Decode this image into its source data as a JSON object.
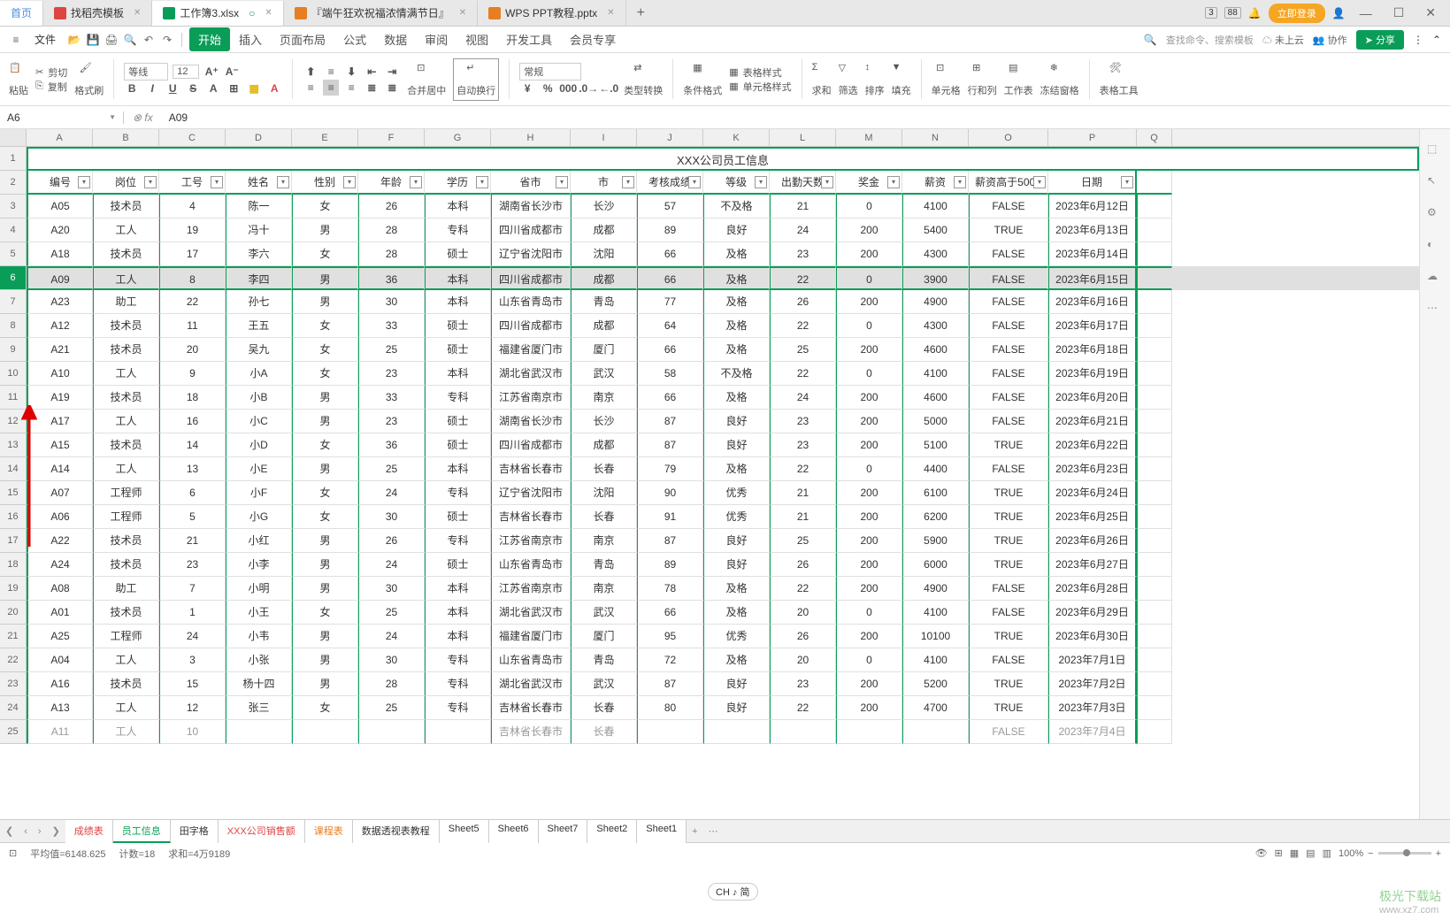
{
  "tabbar": {
    "home": "首页",
    "tabs": [
      {
        "icon": "doc",
        "label": "找稻壳模板"
      },
      {
        "icon": "xls",
        "label": "工作簿3.xlsx",
        "active": true,
        "dirty": true
      },
      {
        "icon": "ppt",
        "label": "『端午狂欢祝福浓情满节日』"
      },
      {
        "icon": "ppt",
        "label": "WPS PPT教程.pptx"
      }
    ],
    "badge1": "3",
    "badge2": "88",
    "login": "立即登录"
  },
  "menubar": {
    "file": "文件",
    "tabs": [
      "开始",
      "插入",
      "页面布局",
      "公式",
      "数据",
      "审阅",
      "视图",
      "开发工具",
      "会员专享"
    ],
    "search_placeholder": "查找命令、搜索模板",
    "cloud": "未上云",
    "coop": "协作",
    "share": "分享"
  },
  "ribbon": {
    "paste": "粘贴",
    "cut": "剪切",
    "copy": "复制",
    "fmtpaint": "格式刷",
    "font": "等线",
    "size": "12",
    "merge": "合并居中",
    "wrap": "自动换行",
    "numfmt": "常规",
    "typeconv": "类型转换",
    "condfmt": "条件格式",
    "tblstyle": "表格样式",
    "cellstyle": "单元格样式",
    "sum": "求和",
    "filter": "筛选",
    "sort": "排序",
    "fill": "填充",
    "cell": "单元格",
    "rowcol": "行和列",
    "sheet": "工作表",
    "freeze": "冻结窗格",
    "tools": "表格工具"
  },
  "fbar": {
    "namebox": "A6",
    "value": "A09"
  },
  "columns": [
    "A",
    "B",
    "C",
    "D",
    "E",
    "F",
    "G",
    "H",
    "I",
    "J",
    "K",
    "L",
    "M",
    "N",
    "O",
    "P",
    "Q"
  ],
  "title": "XXX公司员工信息",
  "headers": [
    "编号",
    "岗位",
    "工号",
    "姓名",
    "性别",
    "年龄",
    "学历",
    "省市",
    "市",
    "考核成绩",
    "等级",
    "出勤天数",
    "奖金",
    "薪资",
    "薪资高于5000",
    "日期"
  ],
  "rows": [
    {
      "n": 3,
      "d": [
        "A05",
        "技术员",
        "4",
        "陈一",
        "女",
        "26",
        "本科",
        "湖南省长沙市",
        "长沙",
        "57",
        "不及格",
        "21",
        "0",
        "4100",
        "FALSE",
        "2023年6月12日"
      ]
    },
    {
      "n": 4,
      "d": [
        "A20",
        "工人",
        "19",
        "冯十",
        "男",
        "28",
        "专科",
        "四川省成都市",
        "成都",
        "89",
        "良好",
        "24",
        "200",
        "5400",
        "TRUE",
        "2023年6月13日"
      ]
    },
    {
      "n": 5,
      "d": [
        "A18",
        "技术员",
        "17",
        "李六",
        "女",
        "28",
        "硕士",
        "辽宁省沈阳市",
        "沈阳",
        "66",
        "及格",
        "23",
        "200",
        "4300",
        "FALSE",
        "2023年6月14日"
      ]
    },
    {
      "n": 6,
      "sel": true,
      "d": [
        "A09",
        "工人",
        "8",
        "李四",
        "男",
        "36",
        "本科",
        "四川省成都市",
        "成都",
        "66",
        "及格",
        "22",
        "0",
        "3900",
        "FALSE",
        "2023年6月15日"
      ]
    },
    {
      "n": 7,
      "d": [
        "A23",
        "助工",
        "22",
        "孙七",
        "男",
        "30",
        "本科",
        "山东省青岛市",
        "青岛",
        "77",
        "及格",
        "26",
        "200",
        "4900",
        "FALSE",
        "2023年6月16日"
      ]
    },
    {
      "n": 8,
      "d": [
        "A12",
        "技术员",
        "11",
        "王五",
        "女",
        "33",
        "硕士",
        "四川省成都市",
        "成都",
        "64",
        "及格",
        "22",
        "0",
        "4300",
        "FALSE",
        "2023年6月17日"
      ]
    },
    {
      "n": 9,
      "d": [
        "A21",
        "技术员",
        "20",
        "吴九",
        "女",
        "25",
        "硕士",
        "福建省厦门市",
        "厦门",
        "66",
        "及格",
        "25",
        "200",
        "4600",
        "FALSE",
        "2023年6月18日"
      ]
    },
    {
      "n": 10,
      "d": [
        "A10",
        "工人",
        "9",
        "小A",
        "女",
        "23",
        "本科",
        "湖北省武汉市",
        "武汉",
        "58",
        "不及格",
        "22",
        "0",
        "4100",
        "FALSE",
        "2023年6月19日"
      ]
    },
    {
      "n": 11,
      "d": [
        "A19",
        "技术员",
        "18",
        "小B",
        "男",
        "33",
        "专科",
        "江苏省南京市",
        "南京",
        "66",
        "及格",
        "24",
        "200",
        "4600",
        "FALSE",
        "2023年6月20日"
      ]
    },
    {
      "n": 12,
      "d": [
        "A17",
        "工人",
        "16",
        "小C",
        "男",
        "23",
        "硕士",
        "湖南省长沙市",
        "长沙",
        "87",
        "良好",
        "23",
        "200",
        "5000",
        "FALSE",
        "2023年6月21日"
      ]
    },
    {
      "n": 13,
      "d": [
        "A15",
        "技术员",
        "14",
        "小D",
        "女",
        "36",
        "硕士",
        "四川省成都市",
        "成都",
        "87",
        "良好",
        "23",
        "200",
        "5100",
        "TRUE",
        "2023年6月22日"
      ]
    },
    {
      "n": 14,
      "d": [
        "A14",
        "工人",
        "13",
        "小E",
        "男",
        "25",
        "本科",
        "吉林省长春市",
        "长春",
        "79",
        "及格",
        "22",
        "0",
        "4400",
        "FALSE",
        "2023年6月23日"
      ]
    },
    {
      "n": 15,
      "d": [
        "A07",
        "工程师",
        "6",
        "小F",
        "女",
        "24",
        "专科",
        "辽宁省沈阳市",
        "沈阳",
        "90",
        "优秀",
        "21",
        "200",
        "6100",
        "TRUE",
        "2023年6月24日"
      ]
    },
    {
      "n": 16,
      "d": [
        "A06",
        "工程师",
        "5",
        "小G",
        "女",
        "30",
        "硕士",
        "吉林省长春市",
        "长春",
        "91",
        "优秀",
        "21",
        "200",
        "6200",
        "TRUE",
        "2023年6月25日"
      ]
    },
    {
      "n": 17,
      "d": [
        "A22",
        "技术员",
        "21",
        "小红",
        "男",
        "26",
        "专科",
        "江苏省南京市",
        "南京",
        "87",
        "良好",
        "25",
        "200",
        "5900",
        "TRUE",
        "2023年6月26日"
      ]
    },
    {
      "n": 18,
      "d": [
        "A24",
        "技术员",
        "23",
        "小李",
        "男",
        "24",
        "硕士",
        "山东省青岛市",
        "青岛",
        "89",
        "良好",
        "26",
        "200",
        "6000",
        "TRUE",
        "2023年6月27日"
      ]
    },
    {
      "n": 19,
      "d": [
        "A08",
        "助工",
        "7",
        "小明",
        "男",
        "30",
        "本科",
        "江苏省南京市",
        "南京",
        "78",
        "及格",
        "22",
        "200",
        "4900",
        "FALSE",
        "2023年6月28日"
      ]
    },
    {
      "n": 20,
      "d": [
        "A01",
        "技术员",
        "1",
        "小王",
        "女",
        "25",
        "本科",
        "湖北省武汉市",
        "武汉",
        "66",
        "及格",
        "20",
        "0",
        "4100",
        "FALSE",
        "2023年6月29日"
      ]
    },
    {
      "n": 21,
      "d": [
        "A25",
        "工程师",
        "24",
        "小韦",
        "男",
        "24",
        "本科",
        "福建省厦门市",
        "厦门",
        "95",
        "优秀",
        "26",
        "200",
        "10100",
        "TRUE",
        "2023年6月30日"
      ]
    },
    {
      "n": 22,
      "d": [
        "A04",
        "工人",
        "3",
        "小张",
        "男",
        "30",
        "专科",
        "山东省青岛市",
        "青岛",
        "72",
        "及格",
        "20",
        "0",
        "4100",
        "FALSE",
        "2023年7月1日"
      ]
    },
    {
      "n": 23,
      "d": [
        "A16",
        "技术员",
        "15",
        "杨十四",
        "男",
        "28",
        "专科",
        "湖北省武汉市",
        "武汉",
        "87",
        "良好",
        "23",
        "200",
        "5200",
        "TRUE",
        "2023年7月2日"
      ]
    },
    {
      "n": 24,
      "d": [
        "A13",
        "工人",
        "12",
        "张三",
        "女",
        "25",
        "专科",
        "吉林省长春市",
        "长春",
        "80",
        "良好",
        "22",
        "200",
        "4700",
        "TRUE",
        "2023年7月3日"
      ]
    },
    {
      "n": 25,
      "last": true,
      "d": [
        "A11",
        "工人",
        "10",
        "",
        "",
        "",
        "",
        "吉林省长春市",
        "长春",
        "",
        "",
        "",
        "",
        "",
        "FALSE",
        "2023年7月4日"
      ]
    }
  ],
  "sheettabs": {
    "tabs": [
      {
        "label": "成绩表",
        "cls": "red"
      },
      {
        "label": "员工信息",
        "cls": "active"
      },
      {
        "label": "田字格"
      },
      {
        "label": "XXX公司销售额",
        "cls": "red"
      },
      {
        "label": "课程表",
        "cls": "orange"
      },
      {
        "label": "数据透视表教程"
      },
      {
        "label": "Sheet5"
      },
      {
        "label": "Sheet6"
      },
      {
        "label": "Sheet7"
      },
      {
        "label": "Sheet2"
      },
      {
        "label": "Sheet1"
      }
    ]
  },
  "statusbar": {
    "avg": "平均值=6148.625",
    "count": "计数=18",
    "sum": "求和=4万9189",
    "ime": "CH ♪ 简",
    "zoom": "100%"
  },
  "watermark": {
    "t": "极光下载站",
    "s": "www.xz7.com"
  }
}
